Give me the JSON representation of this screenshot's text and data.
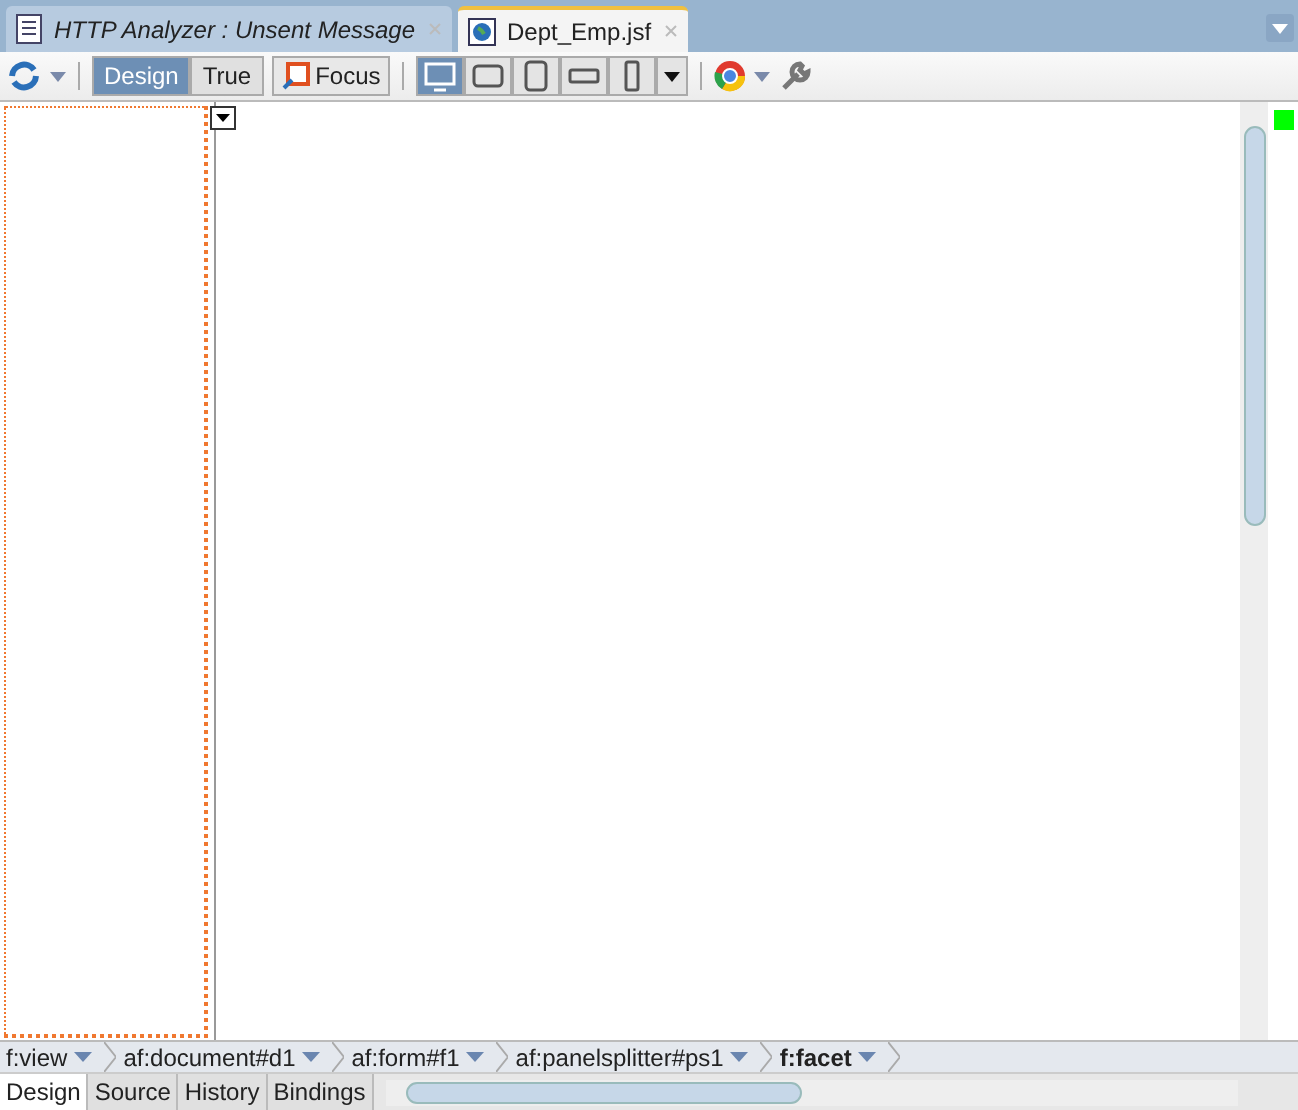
{
  "editor_tabs": [
    {
      "label": "HTTP Analyzer : Unsent Message",
      "selected": false
    },
    {
      "label": "Dept_Emp.jsf",
      "selected": true
    }
  ],
  "toolbar": {
    "modes": [
      {
        "label": "Design",
        "selected": true
      },
      {
        "label": "True",
        "selected": false
      }
    ],
    "focus_button": "Focus",
    "devices": [
      {
        "kind": "desktop",
        "selected": true
      },
      {
        "kind": "tablet-landscape",
        "selected": false
      },
      {
        "kind": "tablet-portrait",
        "selected": false
      },
      {
        "kind": "phone-landscape",
        "selected": false
      },
      {
        "kind": "phone-portrait",
        "selected": false
      }
    ]
  },
  "breadcrumb": [
    {
      "label": "f:view",
      "selected": false
    },
    {
      "label": "af:document#d1",
      "selected": false
    },
    {
      "label": "af:form#f1",
      "selected": false
    },
    {
      "label": "af:panelsplitter#ps1",
      "selected": false
    },
    {
      "label": "f:facet",
      "selected": true
    }
  ],
  "bottom_tabs": [
    {
      "label": "Design",
      "selected": true
    },
    {
      "label": "Source",
      "selected": false
    },
    {
      "label": "History",
      "selected": false
    },
    {
      "label": "Bindings",
      "selected": false
    }
  ]
}
